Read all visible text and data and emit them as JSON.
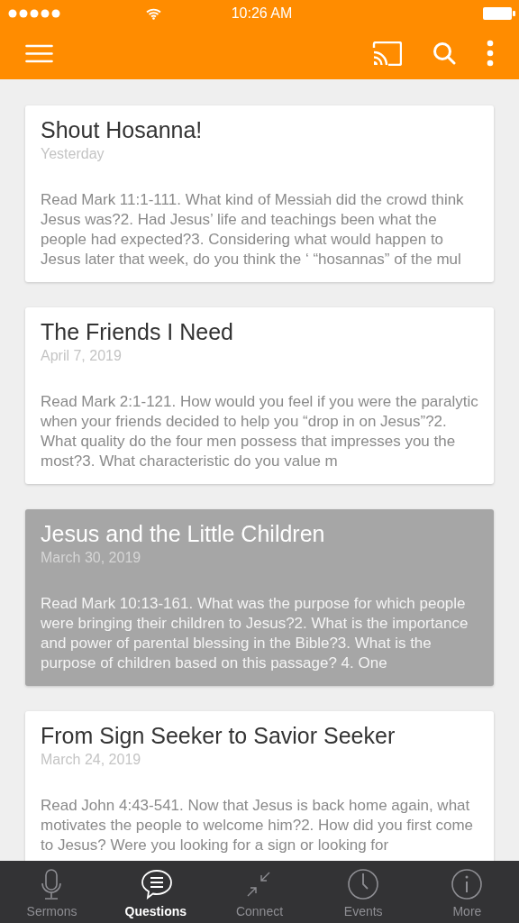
{
  "status_bar": {
    "time": "10:26 AM"
  },
  "cards": [
    {
      "title": "Shout Hosanna!",
      "date": "Yesterday",
      "excerpt": "Read Mark 11:1-111. What kind of Messiah did the crowd think Jesus was?2. Had Jesus’ life and teachings been what the people had expected?3. Considering what would happen to Jesus later that week, do you think the ‘ “hosannas” of the mul",
      "selected": false
    },
    {
      "title": "The Friends I Need",
      "date": "April 7, 2019",
      "excerpt": "Read Mark 2:1-121. How would you feel if you were the paralytic when your friends decided to help you “drop in on Jesus”?2. What quality do the four men possess that impresses you the most?3. What characteristic do you value m",
      "selected": false
    },
    {
      "title": "Jesus and the Little Children",
      "date": "March 30, 2019",
      "excerpt": "Read Mark 10:13-161. What was the purpose for which people were bringing their children to Jesus?2. What is the importance and power of parental blessing in the Bible?3. What is the purpose of children based on this passage? 4. One",
      "selected": true
    },
    {
      "title": "From Sign Seeker to Savior Seeker",
      "date": "March 24, 2019",
      "excerpt": "Read John 4:43-541. Now that Jesus is back home again, what motivates the people to welcome him?2. How did you first come to Jesus? Were you looking for a sign or looking for",
      "selected": false
    }
  ],
  "tabs": [
    {
      "label": "Sermons",
      "kind": "mic",
      "selected": false
    },
    {
      "label": "Questions",
      "kind": "chat",
      "selected": true
    },
    {
      "label": "Connect",
      "kind": "arrows",
      "selected": false
    },
    {
      "label": "Events",
      "kind": "clock",
      "selected": false
    },
    {
      "label": "More",
      "kind": "info",
      "selected": false
    }
  ]
}
